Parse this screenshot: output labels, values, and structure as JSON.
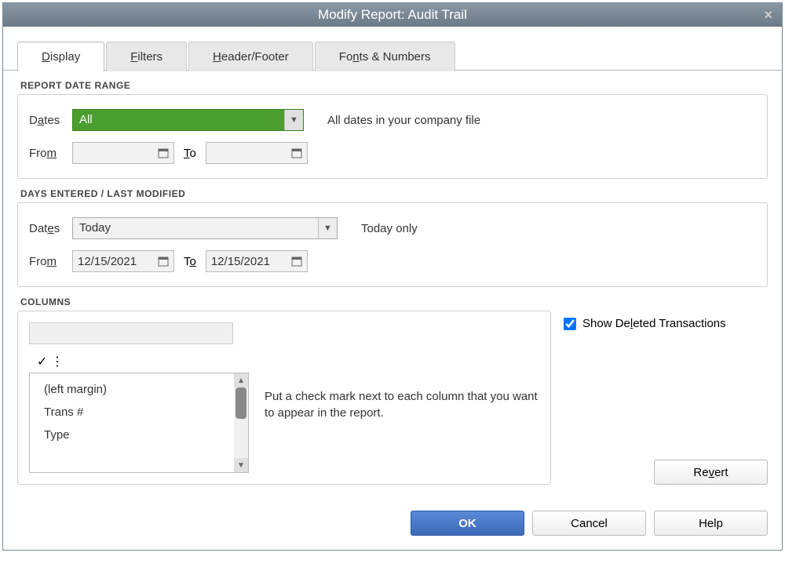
{
  "window": {
    "title": "Modify Report: Audit Trail"
  },
  "tabs": [
    {
      "label": "Display",
      "underline": 0,
      "active": true
    },
    {
      "label": "Filters",
      "underline": 0,
      "active": false
    },
    {
      "label": "Header/Footer",
      "underline": 0,
      "active": false
    },
    {
      "label": "Fonts & Numbers",
      "underline": 2,
      "active": false
    }
  ],
  "report_date_range": {
    "section_label": "REPORT DATE RANGE",
    "dates_label": "Dates",
    "dates_value": "All",
    "dates_hint": "All dates in your company file",
    "from_label": "From",
    "from_value": "",
    "to_label": "To",
    "to_value": ""
  },
  "days_entered": {
    "section_label": "DAYS ENTERED / LAST MODIFIED",
    "dates_label": "Dates",
    "dates_value": "Today",
    "dates_hint": "Today only",
    "from_label": "From",
    "from_value": "12/15/2021",
    "to_label": "To",
    "to_value": "12/15/2021"
  },
  "columns": {
    "section_label": "COLUMNS",
    "items": [
      "(left margin)",
      "Trans #",
      "Type"
    ],
    "hint": "Put a check mark next to each column that you want to appear in the report.",
    "show_deleted_label": "Show Deleted Transactions",
    "show_deleted_checked": true,
    "revert_label": "Revert"
  },
  "buttons": {
    "ok": "OK",
    "cancel": "Cancel",
    "help": "Help"
  }
}
